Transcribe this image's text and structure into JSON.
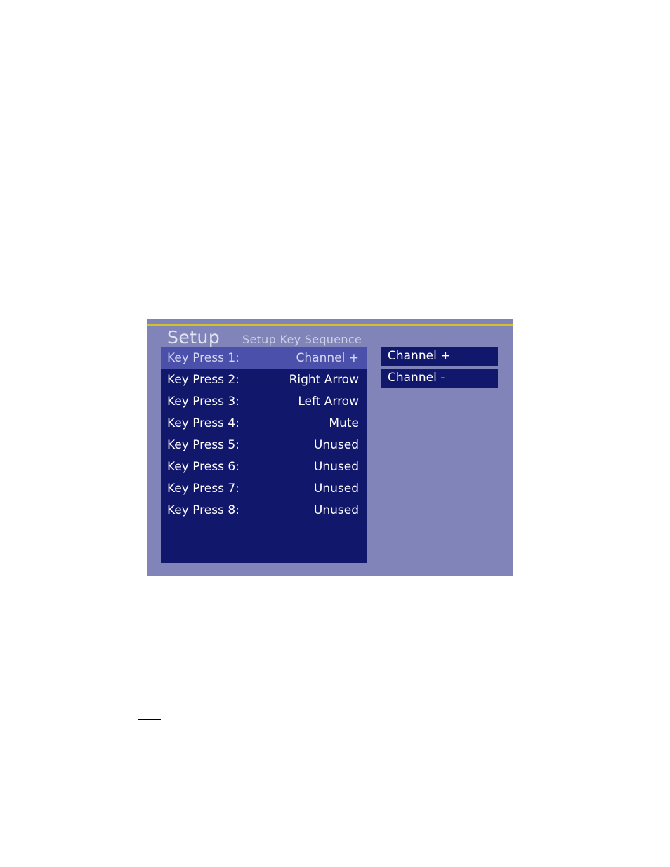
{
  "panel": {
    "title": "Setup",
    "subtitle": "Setup Key Sequence",
    "colors": {
      "panel_background": "#8084b8",
      "accent_line": "#d4c229",
      "list_background": "#11176b",
      "selected_row": "#4b51ab",
      "text": "#ffffff",
      "title_text": "#e2e4f4"
    },
    "key_press_rows": [
      {
        "label": "Key Press 1:",
        "value": "Channel +",
        "selected": true
      },
      {
        "label": "Key Press 2:",
        "value": "Right Arrow",
        "selected": false
      },
      {
        "label": "Key Press 3:",
        "value": "Left Arrow",
        "selected": false
      },
      {
        "label": "Key Press 4:",
        "value": "Mute",
        "selected": false
      },
      {
        "label": "Key Press 5:",
        "value": "Unused",
        "selected": false
      },
      {
        "label": "Key Press 6:",
        "value": "Unused",
        "selected": false
      },
      {
        "label": "Key Press 7:",
        "value": "Unused",
        "selected": false
      },
      {
        "label": "Key Press 8:",
        "value": "Unused",
        "selected": false
      }
    ],
    "dropdown_options": [
      {
        "label": "Channel +"
      },
      {
        "label": "Channel -"
      }
    ]
  }
}
